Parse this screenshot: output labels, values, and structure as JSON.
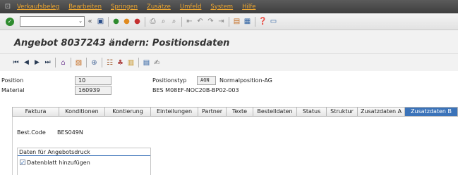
{
  "menu": {
    "items": [
      "Verkaufsbeleg",
      "Bearbeiten",
      "Springen",
      "Zusätze",
      "Umfeld",
      "System",
      "Hilfe"
    ]
  },
  "toolbar": {
    "command_value": "",
    "icons": [
      "enter-icon",
      "save-icon",
      "back-icon",
      "exit-icon",
      "cancel-icon",
      "print-icon",
      "find-icon",
      "find-next-icon",
      "first-page-icon",
      "prev-page-icon",
      "next-page-icon",
      "last-page-icon",
      "new-session-icon",
      "shortcut-icon",
      "help-icon",
      "layout-icon"
    ]
  },
  "title": "Angebot 8037243 ändern: Positionsdaten",
  "fields": {
    "position_label": "Position",
    "position_value": "10",
    "positionstyp_label": "Positionstyp",
    "positionstyp_value": "AGN",
    "positionstyp_text": "Normalposition-AG",
    "material_label": "Material",
    "material_value": "160939",
    "material_text": "BES M08EF-NOC20B-BP02-003"
  },
  "tabs": [
    "Faktura",
    "Konditionen",
    "Kontierung",
    "Einteilungen",
    "Partner",
    "Texte",
    "Bestelldaten",
    "Status",
    "Struktur",
    "Zusatzdaten A",
    "Zusatzdaten B"
  ],
  "active_tab": "Zusatzdaten B",
  "content": {
    "best_code_label": "Best.Code",
    "best_code_value": "BES049N",
    "group_title": "Daten für Angebotsdruck",
    "checkbox_label": "Datenblatt hinzufügen",
    "checkbox_checked": true
  }
}
